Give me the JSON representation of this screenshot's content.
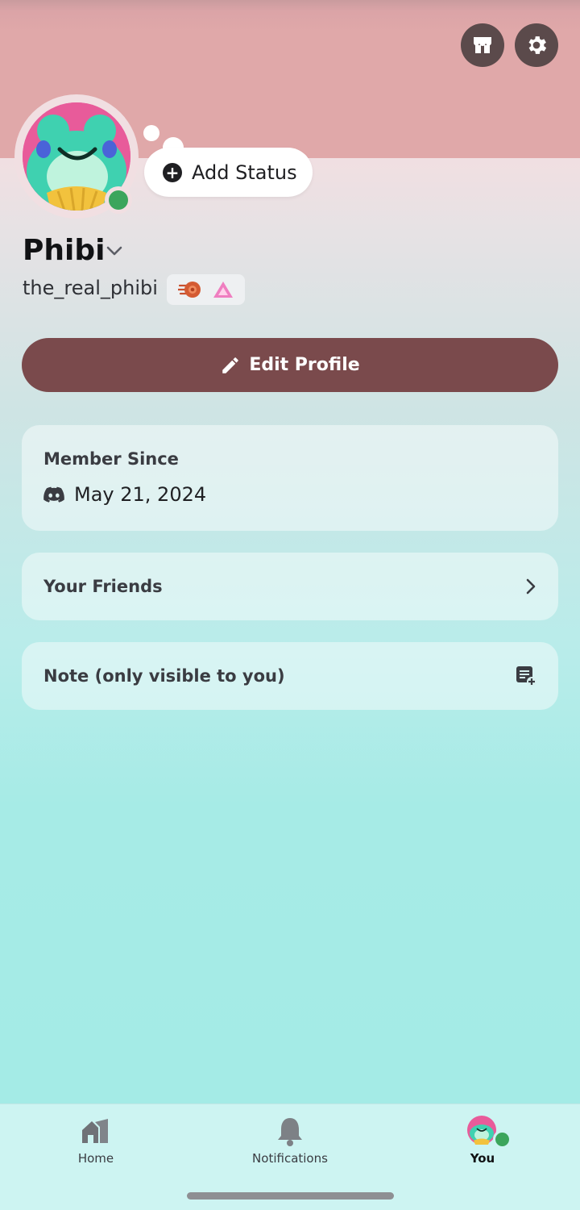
{
  "profile": {
    "display_name": "Phibi",
    "username": "the_real_phibi",
    "add_status_label": "Add Status",
    "edit_profile_label": "Edit Profile"
  },
  "member_since": {
    "title": "Member Since",
    "date": "May 21, 2024"
  },
  "friends": {
    "label": "Your Friends"
  },
  "note": {
    "label": "Note (only visible to you)"
  },
  "tabs": [
    {
      "label": "Home",
      "icon": "home-icon"
    },
    {
      "label": "Notifications",
      "icon": "bell-icon"
    },
    {
      "label": "You",
      "icon": "avatar"
    }
  ],
  "colors": {
    "banner": "#e0a8a9",
    "edit_button": "#7a4a4c",
    "online": "#3ba55c",
    "background_bottom": "#a4ebe6"
  }
}
